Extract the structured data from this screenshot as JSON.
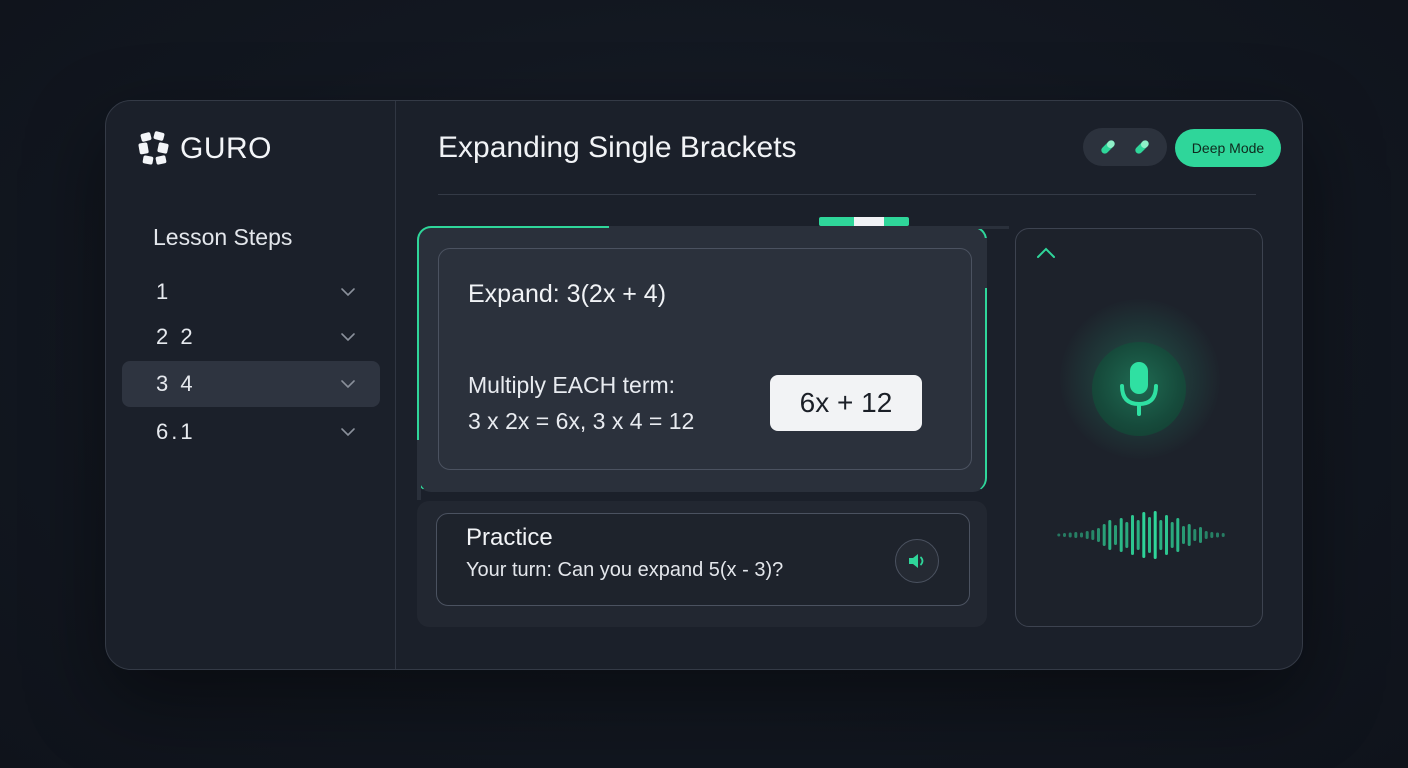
{
  "app": {
    "name": "GURO"
  },
  "sidebar": {
    "title": "Lesson Steps",
    "items": [
      {
        "label": "1"
      },
      {
        "label": "2 2"
      },
      {
        "label": "3 4",
        "active": true
      },
      {
        "label": "6.1"
      }
    ]
  },
  "header": {
    "title": "Expanding Single Brackets",
    "deep_mode_label": "Deep Mode",
    "tool_icons": [
      "pill-icon",
      "pill-icon"
    ]
  },
  "lesson": {
    "expand": "Expand: 3(2x + 4)",
    "instruction_line1": "Multiply EACH term:",
    "instruction_line2": "3 x 2x = 6x, 3 x 4 = 12",
    "answer": "6x + 12"
  },
  "practice": {
    "title": "Practice",
    "prompt": "Your turn: Can you expand 5(x - 3)?"
  },
  "colors": {
    "accent": "#2fd69a",
    "background": "#121720",
    "panel": "#1b202a",
    "card": "#2a303b"
  },
  "icons": {
    "collapse": "chevron-up-icon",
    "mic": "microphone-icon",
    "speaker": "speaker-icon",
    "waveform": "waveform-icon"
  }
}
